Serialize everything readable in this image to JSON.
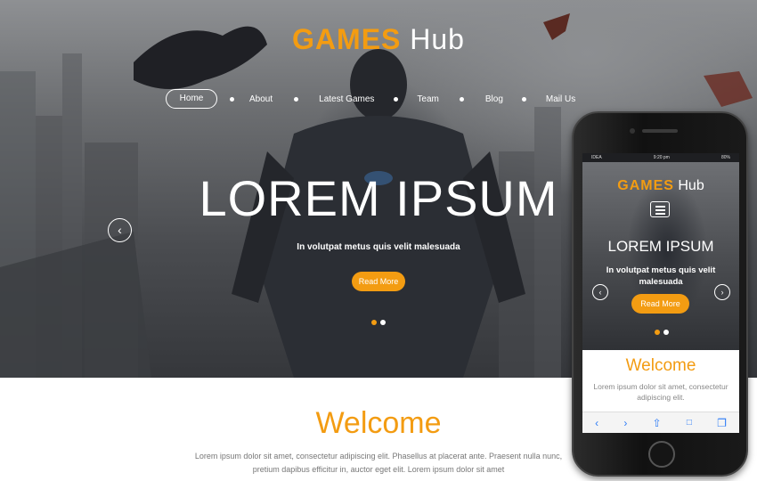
{
  "logo": {
    "brand": "GAMES",
    "suffix": "Hub"
  },
  "nav": {
    "items": [
      "Home",
      "About",
      "Latest Games",
      "Team",
      "Blog",
      "Mail Us"
    ],
    "active": "Home"
  },
  "hero": {
    "title": "LOREM IPSUM",
    "subtitle": "In volutpat metus quis velit malesuada",
    "button": "Read More",
    "prev_icon": "‹",
    "slide_count": 2,
    "active_slide": 1
  },
  "welcome": {
    "title": "Welcome",
    "text_line1": "Lorem ipsum dolor sit amet, consectetur adipiscing elit. Phasellus at placerat ante. Praesent nulla nunc,",
    "text_line2": "pretium dapibus efficitur in, auctor eget elit. Lorem ipsum dolor sit amet"
  },
  "phone": {
    "status": {
      "carrier": "IDEA",
      "time": "9:20 pm",
      "battery": "80%"
    },
    "logo": {
      "brand": "GAMES",
      "suffix": "Hub"
    },
    "hero_title": "LOREM IPSUM",
    "hero_subtitle": "In volutpat metus quis velit malesuada",
    "button": "Read More",
    "prev_icon": "‹",
    "next_icon": "›",
    "welcome_title": "Welcome",
    "welcome_text_line1": "Lorem ipsum dolor sit amet, consectetur",
    "welcome_text_line2": "adipiscing elit.",
    "toolbar_icons": [
      "back-icon",
      "forward-icon",
      "share-icon",
      "bookmarks-icon",
      "tabs-icon"
    ],
    "toolbar_glyphs": {
      "back": "‹",
      "forward": "›",
      "share": "⇧",
      "bookmarks": "📖",
      "tabs": "❐"
    }
  },
  "colors": {
    "accent": "#f39c12",
    "text_muted": "#777777",
    "white": "#ffffff"
  }
}
